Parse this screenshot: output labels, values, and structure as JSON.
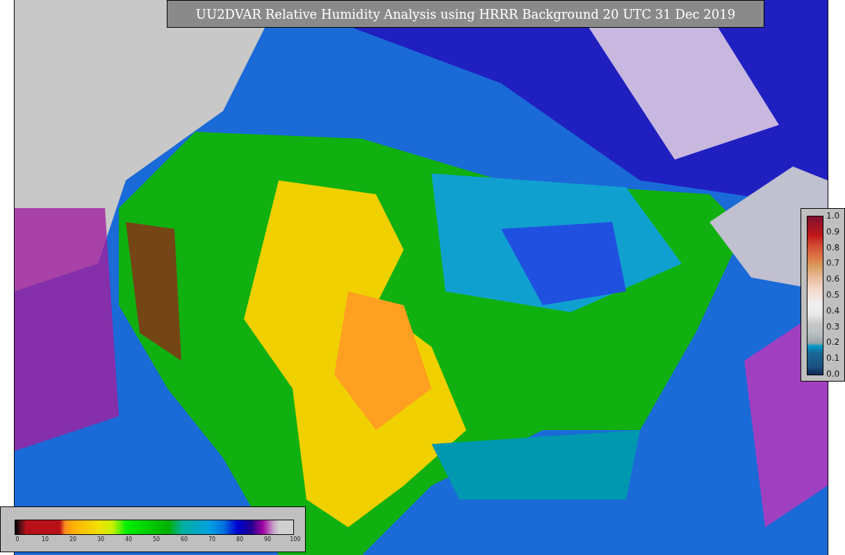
{
  "title": "UU2DVAR Relative Humidity Analysis using HRRR Background 20 UTC 31 Dec 2019",
  "humidity_colorbar": {
    "ticks": [
      "0",
      "10",
      "20",
      "30",
      "40",
      "50",
      "60",
      "70",
      "80",
      "90",
      "100"
    ]
  },
  "ratio_colorbar": {
    "ticks": [
      "1.0",
      "0.9",
      "0.8",
      "0.7",
      "0.6",
      "0.5",
      "0.4",
      "0.3",
      "0.2",
      "0.1",
      "0.0"
    ]
  }
}
